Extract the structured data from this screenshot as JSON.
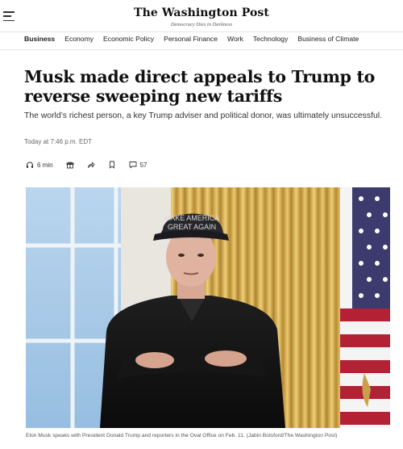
{
  "masthead": {
    "logo": "The Washington Post",
    "tagline": "Democracy Dies in Darkness",
    "menu_icon": "menu-icon"
  },
  "nav": {
    "items": [
      "Business",
      "Economy",
      "Economic Policy",
      "Personal Finance",
      "Work",
      "Technology",
      "Business of Climate"
    ],
    "active": "Business"
  },
  "article": {
    "headline": "Musk made direct appeals to Trump to reverse sweeping new tariffs",
    "dek": "The world’s richest person, a key Trump adviser and political donor, was ultimately unsuccessful.",
    "timestamp": "Today at 7:46 p.m. EDT",
    "actions": {
      "listen_label": "6 min",
      "listen_icon": "headphones-icon",
      "gift_icon": "gift-icon",
      "share_icon": "share-icon",
      "save_icon": "bookmark-icon",
      "comment_icon": "comment-icon",
      "comment_count": "57"
    }
  },
  "photo": {
    "hat_text_line1": "MAKE AMERICA",
    "hat_text_line2": "GREAT AGAIN",
    "caption": "Elon Musk speaks with President Donald Trump and reporters in the Oval Office on Feb. 11. (Jabin Botsford/The Washington Post)"
  },
  "colors": {
    "text": "#111111",
    "muted": "#666666",
    "rule": "#e6e6e6",
    "curtain_gold": "#d7b25a",
    "flag_red": "#b22234",
    "flag_blue": "#3c3b6e"
  }
}
